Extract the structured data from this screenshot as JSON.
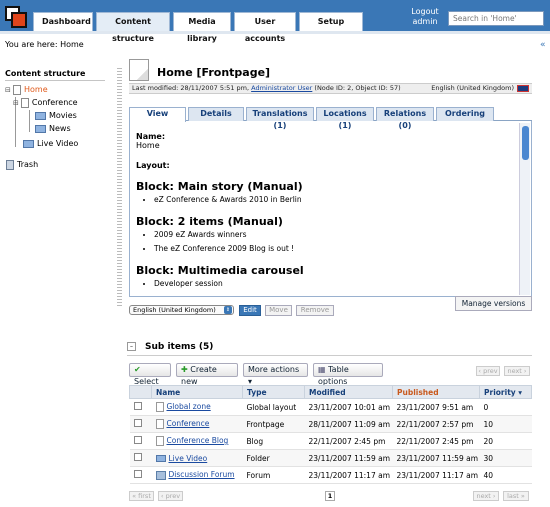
{
  "header": {
    "tabs": [
      "Dashboard",
      "Content structure",
      "Media library",
      "User accounts",
      "Setup"
    ],
    "logout": "Logout",
    "user": "admin",
    "search_placeholder": "Search in 'Home'"
  },
  "breadcrumb": "You are here: Home",
  "tree": {
    "title": "Content structure",
    "items": [
      "Home",
      "Conference",
      "Movies",
      "News",
      "Live Video",
      "Trash"
    ]
  },
  "node": {
    "title": "Home [Frontpage]",
    "meta_prefix": "Last modified: 28/11/2007 5:51 pm,",
    "meta_author": "Administrator User",
    "meta_suffix": "(Node ID: 2, Object ID: 57)",
    "language": "English (United Kingdom)"
  },
  "view_tabs": [
    "View",
    "Details",
    "Translations (1)",
    "Locations (1)",
    "Relations (0)",
    "Ordering"
  ],
  "view": {
    "name_label": "Name:",
    "name_value": "Home",
    "layout_label": "Layout:",
    "blocks": [
      {
        "title": "Block: Main story (Manual)",
        "items": [
          "eZ Conference & Awards 2010 in Berlin"
        ]
      },
      {
        "title": "Block: 2 items (Manual)",
        "items": [
          "2009 eZ Awards winners",
          "The eZ Conference 2009 Blog is out !"
        ]
      },
      {
        "title": "Block: Multimedia carousel",
        "items": [
          "Developer session"
        ]
      }
    ]
  },
  "controls": {
    "language_select": "English (United Kingdom)",
    "edit": "Edit",
    "move": "Move",
    "remove": "Remove",
    "manage_versions": "Manage versions"
  },
  "subitems": {
    "toggle": "–",
    "title": "Sub items (5)",
    "select": "Select",
    "create_new": "Create new",
    "more_actions": "More actions ▾",
    "table_options": "Table options",
    "prev": "‹ prev",
    "next": "next ›",
    "first": "« first",
    "last": "last »",
    "page": "1",
    "columns": [
      "Name",
      "Type",
      "Modified",
      "Published",
      "Priority ▾"
    ],
    "rows": [
      {
        "name": "Global zone",
        "type": "Global layout",
        "modified": "23/11/2007 10:01 am",
        "published": "23/11/2007 9:51 am",
        "priority": "0"
      },
      {
        "name": "Conference",
        "type": "Frontpage",
        "modified": "28/11/2007 11:09 am",
        "published": "22/11/2007 2:57 pm",
        "priority": "10"
      },
      {
        "name": "Conference Blog",
        "type": "Blog",
        "modified": "22/11/2007 2:45 pm",
        "published": "22/11/2007 2:45 pm",
        "priority": "20"
      },
      {
        "name": "Live Video",
        "type": "Folder",
        "modified": "23/11/2007 11:59 am",
        "published": "23/11/2007 11:59 am",
        "priority": "30"
      },
      {
        "name": "Discussion Forum",
        "type": "Forum",
        "modified": "23/11/2007 11:17 am",
        "published": "23/11/2007 11:17 am",
        "priority": "40"
      }
    ]
  }
}
